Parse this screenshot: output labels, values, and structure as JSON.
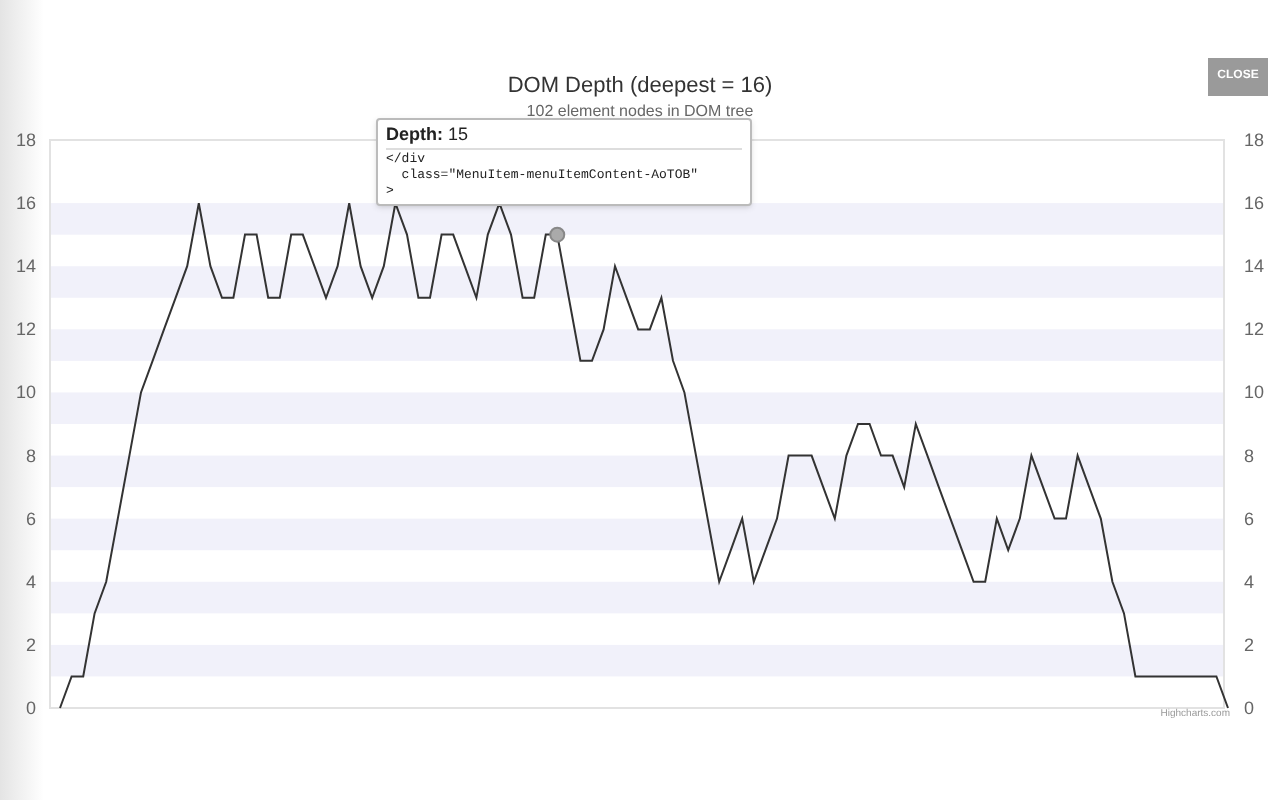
{
  "close_button": {
    "label": "CLOSE"
  },
  "chart": {
    "title": "DOM Depth (deepest = 16)",
    "subtitle": "102 element nodes in DOM tree",
    "credit": "Highcharts.com",
    "chart_data": {
      "type": "line",
      "ylim": [
        0,
        18
      ],
      "yticks": [
        0,
        2,
        4,
        6,
        8,
        10,
        12,
        14,
        16,
        18
      ],
      "bands": [
        {
          "axis": "y",
          "from": 1,
          "to": 2
        },
        {
          "axis": "y",
          "from": 3,
          "to": 4
        },
        {
          "axis": "y",
          "from": 5,
          "to": 6
        },
        {
          "axis": "y",
          "from": 7,
          "to": 8
        },
        {
          "axis": "y",
          "from": 9,
          "to": 10
        },
        {
          "axis": "y",
          "from": 11,
          "to": 12
        },
        {
          "axis": "y",
          "from": 13,
          "to": 14
        },
        {
          "axis": "y",
          "from": 15,
          "to": 16
        }
      ],
      "series": [
        {
          "color": "#333333",
          "values": [
            0,
            1,
            1,
            3,
            4,
            6,
            8,
            10,
            11,
            12,
            13,
            14,
            16,
            14,
            13,
            13,
            15,
            15,
            13,
            13,
            15,
            15,
            14,
            13,
            14,
            16,
            14,
            13,
            14,
            16,
            15,
            13,
            13,
            15,
            15,
            14,
            13,
            15,
            16,
            15,
            13,
            13,
            15,
            15,
            13,
            11,
            11,
            12,
            14,
            13,
            12,
            12,
            13,
            11,
            10,
            8,
            6,
            4,
            5,
            6,
            4,
            5,
            6,
            8,
            8,
            8,
            7,
            6,
            8,
            9,
            9,
            8,
            8,
            7,
            9,
            8,
            7,
            6,
            5,
            4,
            4,
            6,
            5,
            6,
            8,
            7,
            6,
            6,
            8,
            7,
            6,
            4,
            3,
            1,
            1,
            1,
            1,
            1,
            1,
            1,
            1,
            0
          ]
        }
      ]
    },
    "right_axis_labels": [
      "18",
      "16",
      "14",
      "12",
      "10",
      "8",
      "6",
      "4",
      "2",
      "0"
    ]
  },
  "tooltip": {
    "heading": "**Depth:** 15",
    "lines": [
      "</div",
      "  class=\"MenuItem-menuItemContent-AoTOB\"",
      ">"
    ]
  }
}
